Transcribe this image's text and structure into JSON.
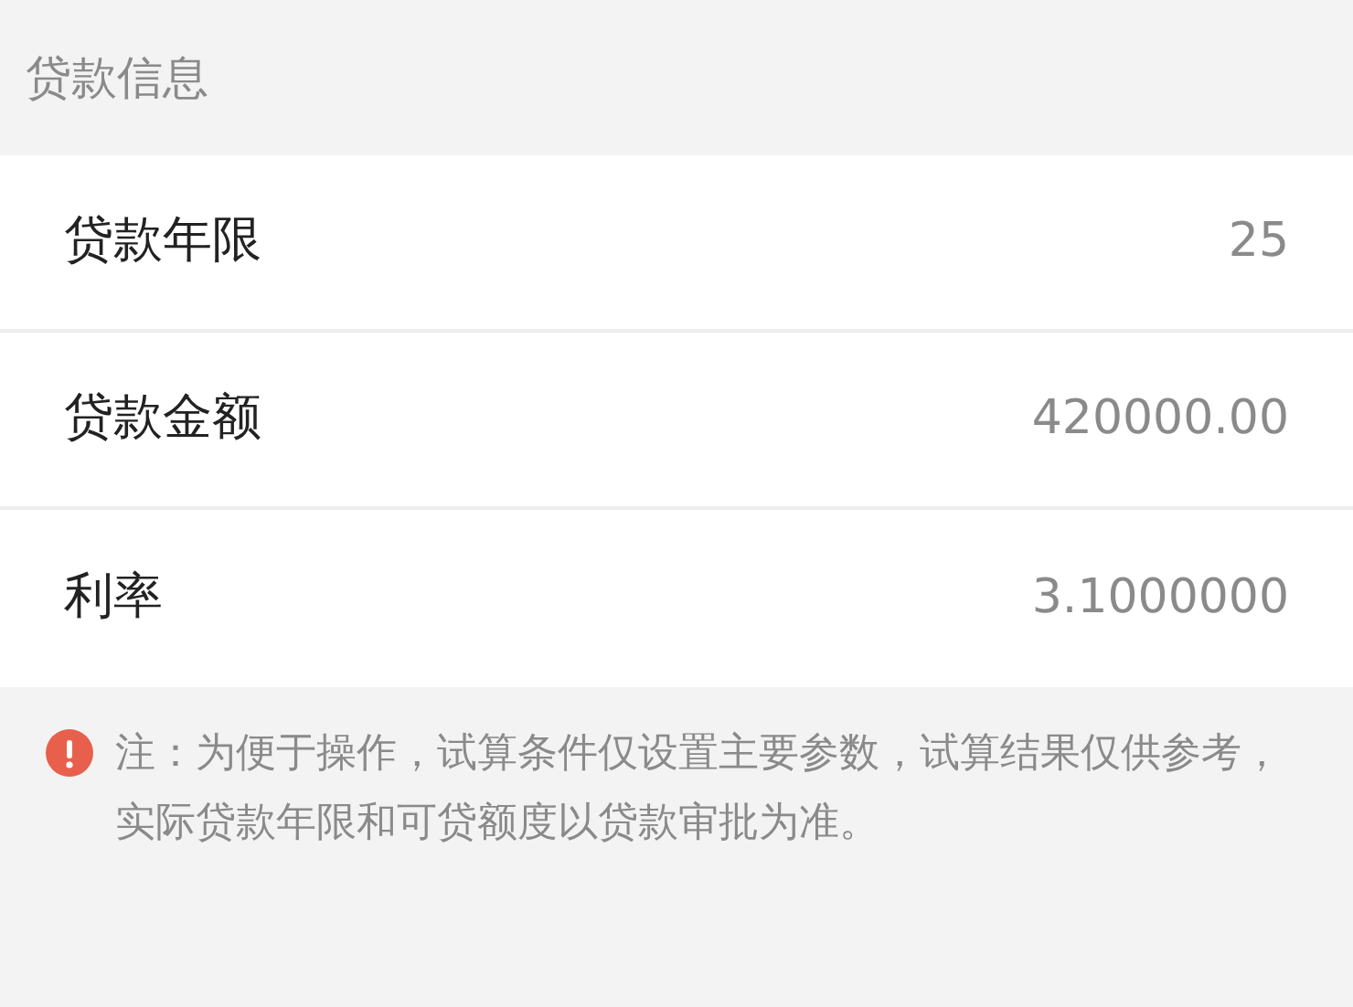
{
  "section_title": "贷款信息",
  "rows": [
    {
      "label": "贷款年限",
      "value": "25"
    },
    {
      "label": "贷款金额",
      "value": "420000.00"
    },
    {
      "label": "利率",
      "value": "3.1000000"
    }
  ],
  "note": "注：为便于操作，试算条件仅设置主要参数，试算结果仅供参考，实际贷款年限和可贷额度以贷款审批为准。"
}
